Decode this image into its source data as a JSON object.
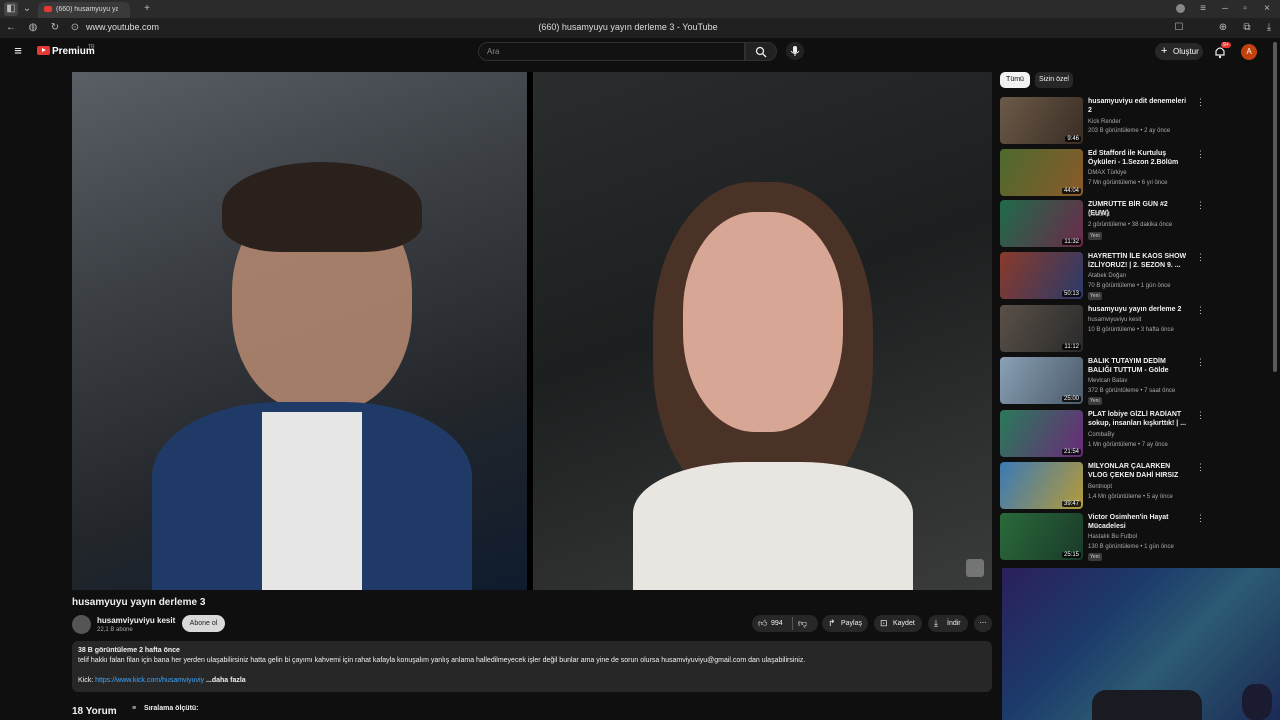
{
  "browser": {
    "tab_title": "(660) husamyuyu yayın derleme 3 - YouTube",
    "url": "www.youtube.com",
    "page_title": "(660) husamyuyu yayın derleme 3 - YouTube"
  },
  "header": {
    "logo_text": "Premium",
    "logo_badge": "TR",
    "search_placeholder": "Ara",
    "create_label": "Oluştur",
    "notif_count": "9+",
    "avatar_letter": "A"
  },
  "video": {
    "title": "husamyuyu yayın derleme 3",
    "channel": "husamviyuviyu kesit",
    "subscribers": "22,1 B abone",
    "subscribe_label": "Abone ol",
    "likes": "994",
    "share_label": "Paylaş",
    "save_label": "Kaydet",
    "download_label": "İndir",
    "more_label": "⋯"
  },
  "description": {
    "stats": "38 B görüntüleme  2 hafta önce",
    "text": "telif hakkı falan filan için bana her yerden ulaşabilirsiniz hatta gelin bi çayımı kahvemi için rahat kafayla konuşalım yanlış anlama halledilmeyecek işler değil bunlar ama yine de sorun olursa husamviyuviyu@gmail.com dan ulaşabilirsiniz.",
    "kick_label": "Kick:",
    "kick_link": "https://www.kick.com/husamviyuviy",
    "more": "...daha fazla"
  },
  "comments": {
    "count_label": "18 Yorum",
    "sort_label": "Sıralama ölçütü:"
  },
  "chips": [
    {
      "label": "Tümü"
    },
    {
      "label": "Sizin özel"
    }
  ],
  "recommended": [
    {
      "title": "husamyuviyu edit denemeleri 2",
      "channel": "Kick Render",
      "meta": "203 B görüntüleme • 2 ay önce",
      "duration": "9:46",
      "new": ""
    },
    {
      "title": "Ed Stafford ile Kurtuluş Öyküleri - 1.Sezon 2.Bölüm (Romanya)",
      "channel": "DMAX Türkiye",
      "meta": "7 Mn görüntüleme • 6 yıl önce",
      "duration": "44:04",
      "new": ""
    },
    {
      "title": "ZÜMRÜTTE BİR GÜN #2 (EUW)",
      "channel": "DodoAd",
      "meta": "2 görüntüleme • 38 dakika önce",
      "duration": "11:32",
      "new": "Yeni"
    },
    {
      "title": "HAYRETTİN İLE KAOS SHOW İZLİYORUZ! | 2. SEZON 9. ...",
      "channel": "Atabek Doğan",
      "meta": "70 B görüntüleme • 1 gün önce",
      "duration": "50:13",
      "new": "Yeni"
    },
    {
      "title": "husamyuyu yayın derleme 2",
      "channel": "husamviyuviyu kesit",
      "meta": "10 B görüntüleme • 3 hafta önce",
      "duration": "11:12",
      "new": ""
    },
    {
      "title": "BALIK TUTAYIM DEDİM BALIĞI TUTTUM - Gölde hipotermi keyfi",
      "channel": "Mevlcan Batav",
      "meta": "372 B görüntüleme • 7 saat önce",
      "duration": "25:00",
      "new": "Yeni"
    },
    {
      "title": "PLAT lobiye GİZLİ RADİANT sokup, insanları kışkırttık! | ...",
      "channel": "CombaBy",
      "meta": "1 Mn görüntüleme • 7 ay önce",
      "duration": "21:54",
      "new": ""
    },
    {
      "title": "MİLYONLAR ÇALARKEN VLOG ÇEKEN DAHİ HIRSIZ",
      "channel": "Bentnopt",
      "meta": "1,4 Mn görüntüleme • 5 ay önce",
      "duration": "39:47",
      "new": ""
    },
    {
      "title": "Victor Osimhen'in Hayat Mücadelesi",
      "channel": "Hastalık Bu Futbol",
      "meta": "130 B görüntüleme • 1 gün önce",
      "duration": "25:15",
      "new": "Yeni"
    }
  ],
  "colors": {
    "background": "#0f0f0f",
    "brand_red": "#e53935",
    "link": "#3ea6ff"
  }
}
